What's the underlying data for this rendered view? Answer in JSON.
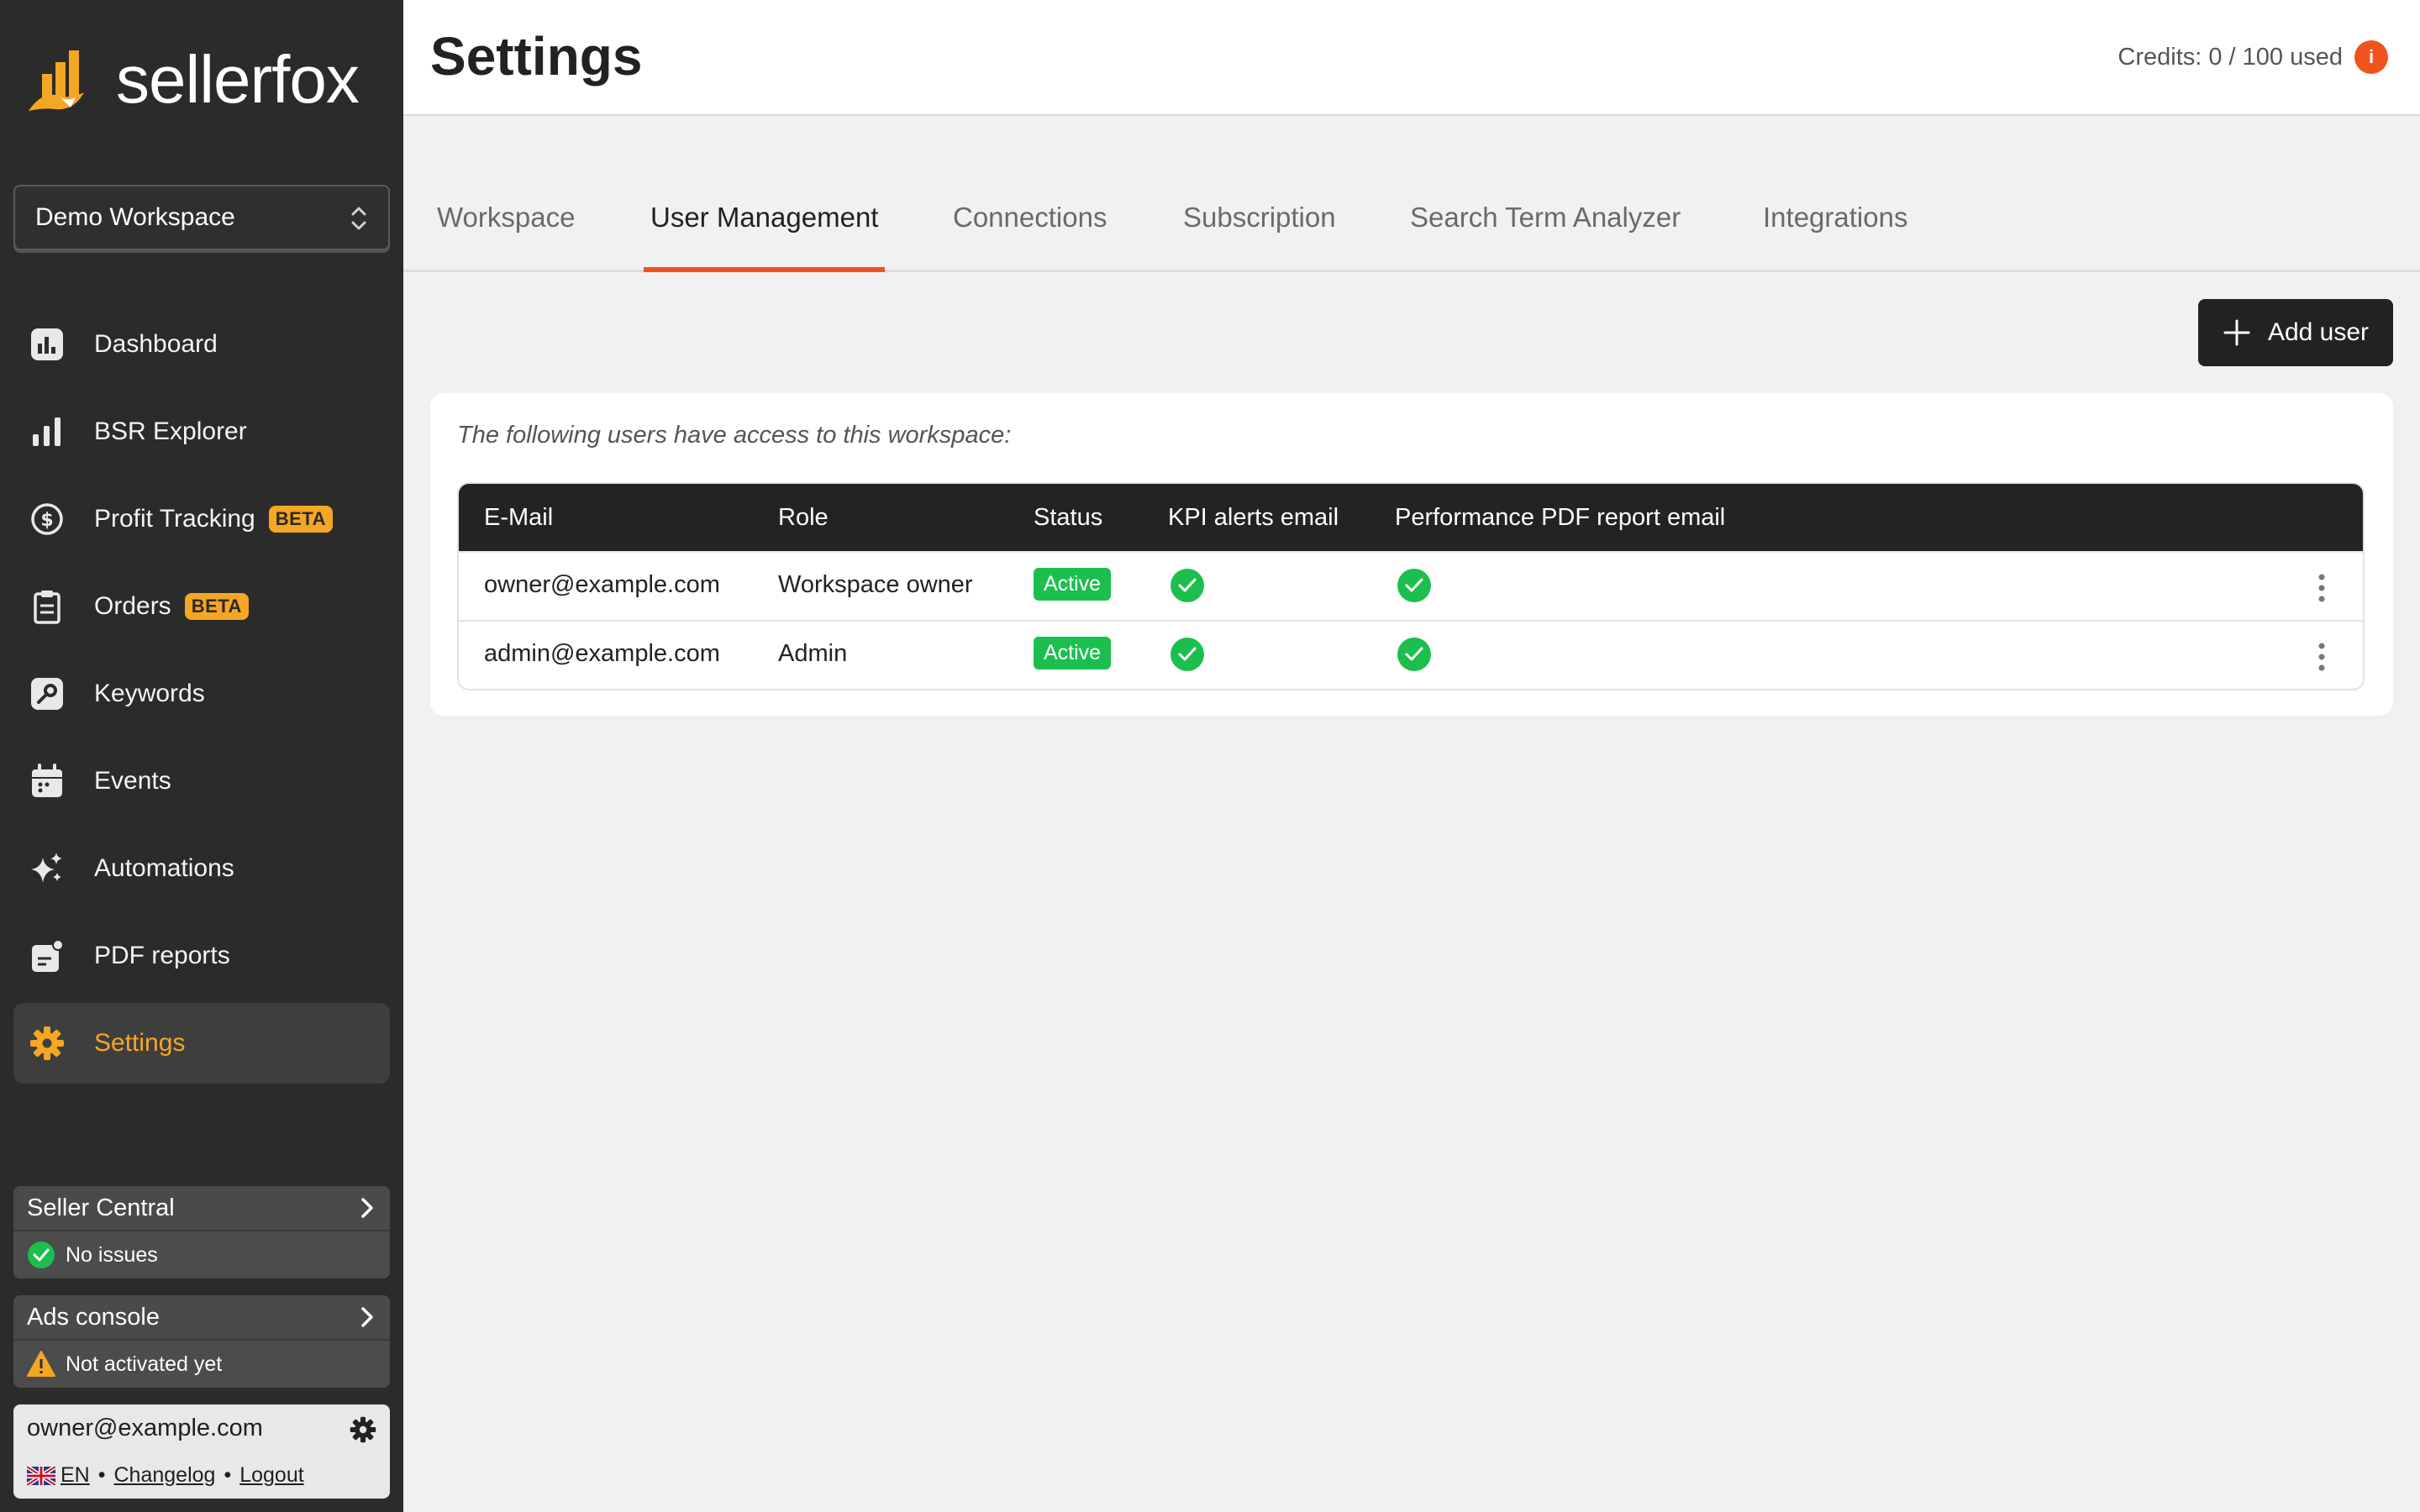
{
  "app": {
    "name": "sellerfox"
  },
  "workspace_select": {
    "value": "Demo Workspace"
  },
  "nav": [
    {
      "label": "Dashboard",
      "icon": "dashboard-icon"
    },
    {
      "label": "BSR Explorer",
      "icon": "bar-chart-icon"
    },
    {
      "label": "Profit Tracking",
      "icon": "dollar-icon",
      "badge": "BETA"
    },
    {
      "label": "Orders",
      "icon": "clipboard-icon",
      "badge": "BETA"
    },
    {
      "label": "Keywords",
      "icon": "key-icon"
    },
    {
      "label": "Events",
      "icon": "calendar-icon"
    },
    {
      "label": "Automations",
      "icon": "sparkle-icon"
    },
    {
      "label": "PDF reports",
      "icon": "report-icon"
    },
    {
      "label": "Settings",
      "icon": "gear-icon",
      "active": true
    }
  ],
  "seller_central": {
    "title": "Seller Central",
    "status": "No issues"
  },
  "ads_console": {
    "title": "Ads console",
    "status": "Not activated yet"
  },
  "user": {
    "email": "owner@example.com",
    "lang": "EN",
    "changelog": "Changelog",
    "logout": "Logout"
  },
  "header": {
    "title": "Settings",
    "credits": "Credits: 0 / 100 used",
    "info": "i"
  },
  "tabs": [
    {
      "label": "Workspace"
    },
    {
      "label": "User Management",
      "active": true
    },
    {
      "label": "Connections"
    },
    {
      "label": "Subscription"
    },
    {
      "label": "Search Term Analyzer"
    },
    {
      "label": "Integrations"
    }
  ],
  "add_user": {
    "label": "Add user"
  },
  "panel": {
    "note": "The following users have access to this workspace:"
  },
  "table": {
    "headers": [
      "E-Mail",
      "Role",
      "Status",
      "KPI alerts email",
      "Performance PDF report email"
    ],
    "rows": [
      {
        "email": "owner@example.com",
        "role": "Workspace owner",
        "status": "Active",
        "kpi": true,
        "pdf": true
      },
      {
        "email": "admin@example.com",
        "role": "Admin",
        "status": "Active",
        "kpi": true,
        "pdf": true
      }
    ]
  },
  "colors": {
    "accent": "#f0541e",
    "brand_orange": "#f5a623",
    "success": "#1cbf4e",
    "sidebar": "#2b2b2b"
  }
}
